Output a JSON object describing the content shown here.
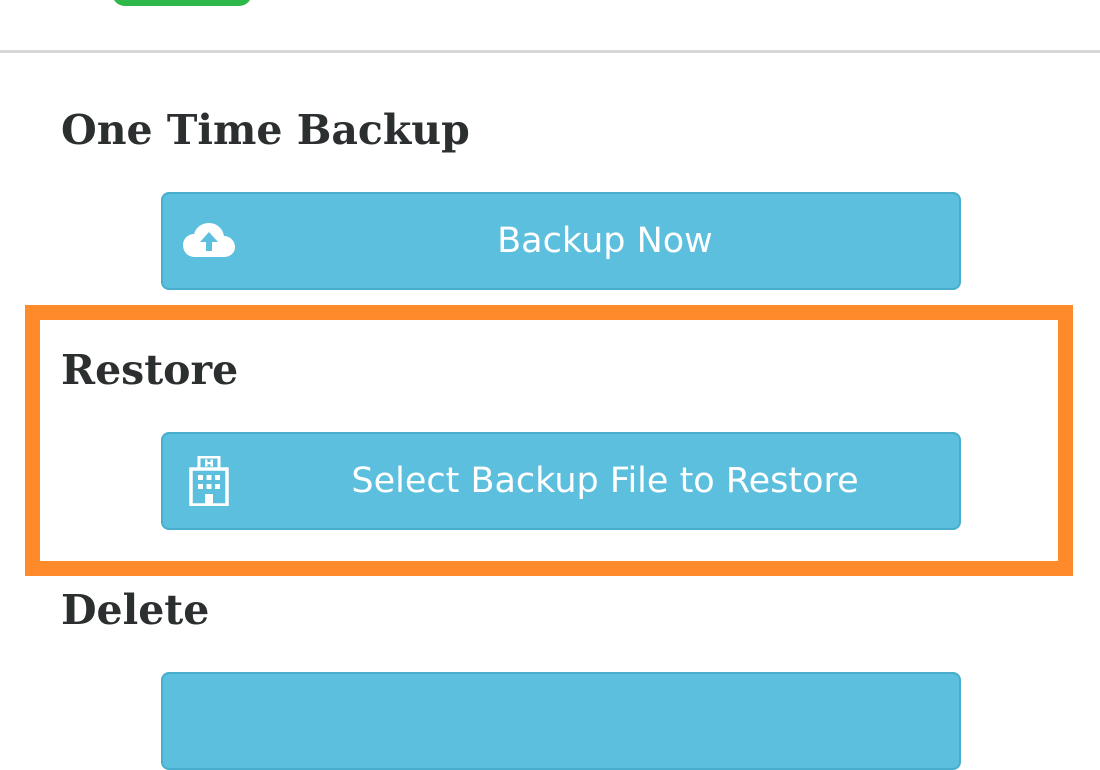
{
  "sections": {
    "one_time_backup": {
      "heading": "One Time Backup",
      "button_label": "Backup Now",
      "button_icon": "cloud-upload-icon"
    },
    "restore": {
      "heading": "Restore",
      "button_label": "Select Backup File to Restore",
      "button_icon": "building-icon"
    },
    "delete": {
      "heading": "Delete"
    }
  },
  "colors": {
    "button_bg": "#5bbfdd",
    "button_border": "#49aecd",
    "heading_text": "#2b2f30",
    "highlight": "#ff8a2a",
    "toggle_on": "#2fb84a",
    "divider": "#d6d6d6"
  }
}
